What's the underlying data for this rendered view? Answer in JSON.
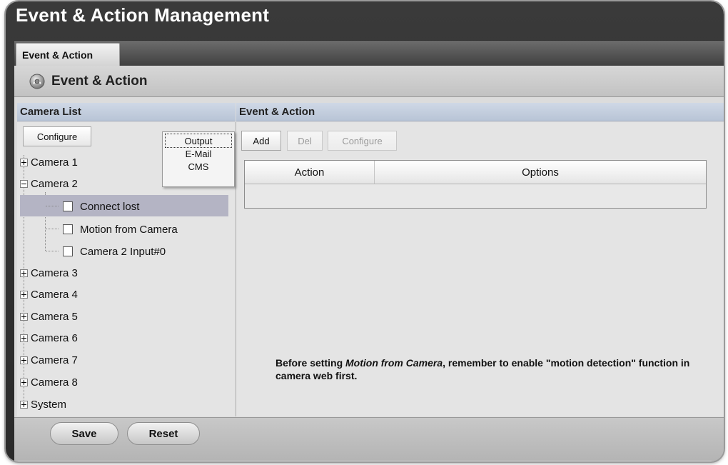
{
  "window": {
    "title": "Event & Action Management"
  },
  "tabs": [
    {
      "label": "Event & Action"
    }
  ],
  "section": {
    "title": "Event & Action",
    "icon": "gear-icon"
  },
  "left": {
    "header": "Camera List",
    "configure_label": "Configure",
    "tree": [
      {
        "label": "Camera 1",
        "expanded": false
      },
      {
        "label": "Camera 2",
        "expanded": true,
        "children": [
          {
            "label": "Connect lost",
            "checked": false,
            "selected": true
          },
          {
            "label": "Motion from Camera",
            "checked": false,
            "selected": false
          },
          {
            "label": "Camera 2 Input#0",
            "checked": false,
            "selected": false
          }
        ]
      },
      {
        "label": "Camera 3",
        "expanded": false
      },
      {
        "label": "Camera 4",
        "expanded": false
      },
      {
        "label": "Camera 5",
        "expanded": false
      },
      {
        "label": "Camera 6",
        "expanded": false
      },
      {
        "label": "Camera 7",
        "expanded": false
      },
      {
        "label": "Camera 8",
        "expanded": false
      },
      {
        "label": "System",
        "expanded": false
      }
    ]
  },
  "dropdown": {
    "items": [
      "Output",
      "E-Mail",
      "CMS"
    ]
  },
  "right": {
    "header": "Event & Action",
    "add_label": "Add",
    "del_label": "Del",
    "configure_label": "Configure",
    "columns": [
      "Action",
      "Options"
    ]
  },
  "footer": {
    "save_label": "Save",
    "reset_label": "Reset",
    "note_pre": "Before setting ",
    "note_em": "Motion from Camera",
    "note_post": ", remember to enable \"motion detection\" function in camera web first."
  },
  "colors": {
    "selection": "#b4b4c4",
    "column_header": "#c4cedd"
  }
}
